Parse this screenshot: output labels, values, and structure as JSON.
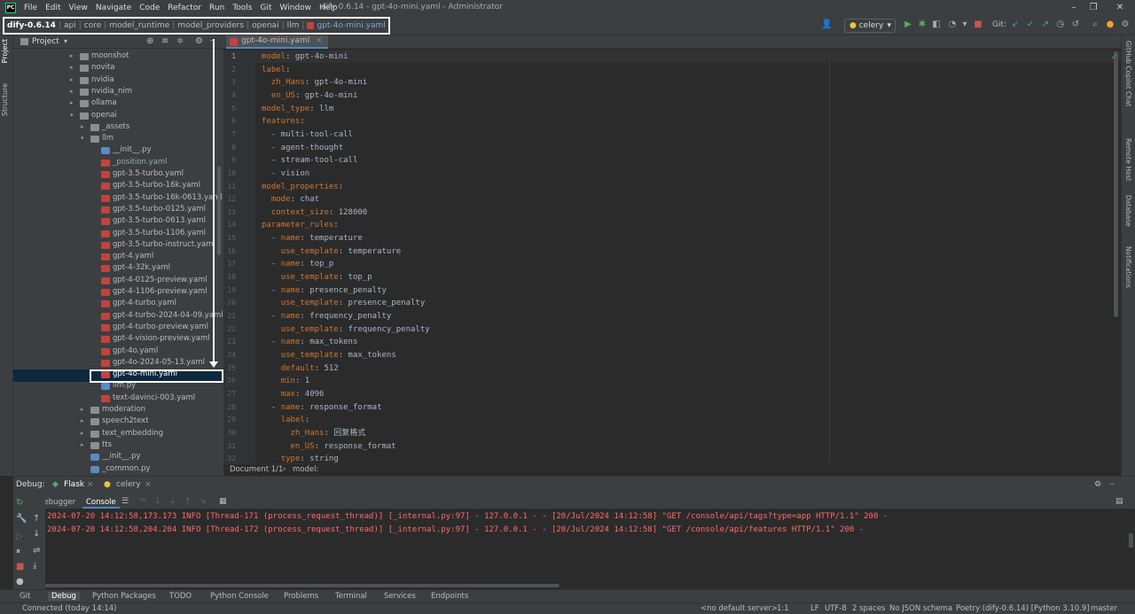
{
  "menu": {
    "items": [
      "File",
      "Edit",
      "View",
      "Navigate",
      "Code",
      "Refactor",
      "Run",
      "Tools",
      "Git",
      "Window",
      "Help"
    ],
    "window_title": "dify-0.6.14 - gpt-4o-mini.yaml - Administrator"
  },
  "navbar": {
    "crumbs": [
      "dify-0.6.14",
      "api",
      "core",
      "model_runtime",
      "model_providers",
      "openai",
      "llm",
      "gpt-4o-mini.yaml"
    ],
    "run_config": "celery",
    "git_label": "Git:"
  },
  "left_strip": {
    "project": "Project",
    "structure": "Structure"
  },
  "project": {
    "title": "Project",
    "tree": [
      {
        "label": "moonshot",
        "kind": "folder",
        "depth": 0,
        "expanded": false
      },
      {
        "label": "novita",
        "kind": "folder",
        "depth": 0,
        "expanded": false
      },
      {
        "label": "nvidia",
        "kind": "folder",
        "depth": 0,
        "expanded": false
      },
      {
        "label": "nvidia_nim",
        "kind": "folder",
        "depth": 0,
        "expanded": false
      },
      {
        "label": "ollama",
        "kind": "folder",
        "depth": 0,
        "expanded": false
      },
      {
        "label": "openai",
        "kind": "folder",
        "depth": 0,
        "expanded": true
      },
      {
        "label": "_assets",
        "kind": "folder",
        "depth": 1,
        "expanded": false
      },
      {
        "label": "llm",
        "kind": "folder",
        "depth": 1,
        "expanded": true
      },
      {
        "label": "__init__.py",
        "kind": "py",
        "depth": 2
      },
      {
        "label": "_position.yaml",
        "kind": "yaml",
        "depth": 2,
        "highlight": true
      },
      {
        "label": "gpt-3.5-turbo.yaml",
        "kind": "yaml",
        "depth": 2
      },
      {
        "label": "gpt-3.5-turbo-16k.yaml",
        "kind": "yaml",
        "depth": 2
      },
      {
        "label": "gpt-3.5-turbo-16k-0613.yaml",
        "kind": "yaml",
        "depth": 2
      },
      {
        "label": "gpt-3.5-turbo-0125.yaml",
        "kind": "yaml",
        "depth": 2
      },
      {
        "label": "gpt-3.5-turbo-0613.yaml",
        "kind": "yaml",
        "depth": 2
      },
      {
        "label": "gpt-3.5-turbo-1106.yaml",
        "kind": "yaml",
        "depth": 2
      },
      {
        "label": "gpt-3.5-turbo-instruct.yaml",
        "kind": "yaml",
        "depth": 2
      },
      {
        "label": "gpt-4.yaml",
        "kind": "yaml",
        "depth": 2
      },
      {
        "label": "gpt-4-32k.yaml",
        "kind": "yaml",
        "depth": 2
      },
      {
        "label": "gpt-4-0125-preview.yaml",
        "kind": "yaml",
        "depth": 2
      },
      {
        "label": "gpt-4-1106-preview.yaml",
        "kind": "yaml",
        "depth": 2
      },
      {
        "label": "gpt-4-turbo.yaml",
        "kind": "yaml",
        "depth": 2
      },
      {
        "label": "gpt-4-turbo-2024-04-09.yaml",
        "kind": "yaml",
        "depth": 2
      },
      {
        "label": "gpt-4-turbo-preview.yaml",
        "kind": "yaml",
        "depth": 2
      },
      {
        "label": "gpt-4-vision-preview.yaml",
        "kind": "yaml",
        "depth": 2
      },
      {
        "label": "gpt-4o.yaml",
        "kind": "yaml",
        "depth": 2
      },
      {
        "label": "gpt-4o-2024-05-13.yaml",
        "kind": "yaml",
        "depth": 2
      },
      {
        "label": "gpt-4o-mini.yaml",
        "kind": "yaml",
        "depth": 2,
        "selected": true
      },
      {
        "label": "llm.py",
        "kind": "py",
        "depth": 2
      },
      {
        "label": "text-davinci-003.yaml",
        "kind": "yaml",
        "depth": 2
      },
      {
        "label": "moderation",
        "kind": "folder",
        "depth": 1,
        "expanded": false
      },
      {
        "label": "speech2text",
        "kind": "folder",
        "depth": 1,
        "expanded": false
      },
      {
        "label": "text_embedding",
        "kind": "folder",
        "depth": 1,
        "expanded": false
      },
      {
        "label": "tts",
        "kind": "folder",
        "depth": 1,
        "expanded": false
      },
      {
        "label": "__init__.py",
        "kind": "py",
        "depth": 1
      },
      {
        "label": "_common.py",
        "kind": "py",
        "depth": 1
      }
    ]
  },
  "editor": {
    "tab": "gpt-4o-mini.yaml",
    "lines": [
      [
        [
          "k",
          "model"
        ],
        [
          "v",
          ": gpt-4o-mini"
        ]
      ],
      [
        [
          "k",
          "label"
        ],
        [
          "v",
          ":"
        ]
      ],
      [
        [
          "v",
          "  "
        ],
        [
          "k",
          "zh_Hans"
        ],
        [
          "v",
          ": gpt-4o-mini"
        ]
      ],
      [
        [
          "v",
          "  "
        ],
        [
          "k",
          "en_US"
        ],
        [
          "v",
          ": gpt-4o-mini"
        ]
      ],
      [
        [
          "k",
          "model_type"
        ],
        [
          "v",
          ": llm"
        ]
      ],
      [
        [
          "k",
          "features"
        ],
        [
          "v",
          ":"
        ]
      ],
      [
        [
          "v",
          "  - multi-tool-call"
        ]
      ],
      [
        [
          "v",
          "  - agent-thought"
        ]
      ],
      [
        [
          "v",
          "  - stream-tool-call"
        ]
      ],
      [
        [
          "v",
          "  - vision"
        ]
      ],
      [
        [
          "k",
          "model_properties"
        ],
        [
          "v",
          ":"
        ]
      ],
      [
        [
          "v",
          "  "
        ],
        [
          "k",
          "mode"
        ],
        [
          "v",
          ": chat"
        ]
      ],
      [
        [
          "v",
          "  "
        ],
        [
          "k",
          "context_size"
        ],
        [
          "v",
          ": 128000"
        ]
      ],
      [
        [
          "k",
          "parameter_rules"
        ],
        [
          "v",
          ":"
        ]
      ],
      [
        [
          "v",
          "  - "
        ],
        [
          "k",
          "name"
        ],
        [
          "v",
          ": temperature"
        ]
      ],
      [
        [
          "v",
          "    "
        ],
        [
          "k",
          "use_template"
        ],
        [
          "v",
          ": temperature"
        ]
      ],
      [
        [
          "v",
          "  - "
        ],
        [
          "k",
          "name"
        ],
        [
          "v",
          ": top_p"
        ]
      ],
      [
        [
          "v",
          "    "
        ],
        [
          "k",
          "use_template"
        ],
        [
          "v",
          ": top_p"
        ]
      ],
      [
        [
          "v",
          "  - "
        ],
        [
          "k",
          "name"
        ],
        [
          "v",
          ": presence_penalty"
        ]
      ],
      [
        [
          "v",
          "    "
        ],
        [
          "k",
          "use_template"
        ],
        [
          "v",
          ": presence_penalty"
        ]
      ],
      [
        [
          "v",
          "  - "
        ],
        [
          "k",
          "name"
        ],
        [
          "v",
          ": frequency_penalty"
        ]
      ],
      [
        [
          "v",
          "    "
        ],
        [
          "k",
          "use_template"
        ],
        [
          "v",
          ": frequency_penalty"
        ]
      ],
      [
        [
          "v",
          "  - "
        ],
        [
          "k",
          "name"
        ],
        [
          "v",
          ": max_tokens"
        ]
      ],
      [
        [
          "v",
          "    "
        ],
        [
          "k",
          "use_template"
        ],
        [
          "v",
          ": max_tokens"
        ]
      ],
      [
        [
          "v",
          "    "
        ],
        [
          "k",
          "default"
        ],
        [
          "v",
          ": 512"
        ]
      ],
      [
        [
          "v",
          "    "
        ],
        [
          "k",
          "min"
        ],
        [
          "v",
          ": 1"
        ]
      ],
      [
        [
          "v",
          "    "
        ],
        [
          "k",
          "max"
        ],
        [
          "v",
          ": 4096"
        ]
      ],
      [
        [
          "v",
          "  - "
        ],
        [
          "k",
          "name"
        ],
        [
          "v",
          ": response_format"
        ]
      ],
      [
        [
          "v",
          "    "
        ],
        [
          "k",
          "label"
        ],
        [
          "v",
          ":"
        ]
      ],
      [
        [
          "v",
          "      "
        ],
        [
          "k",
          "zh_Hans"
        ],
        [
          "v",
          ": 回复格式"
        ]
      ],
      [
        [
          "v",
          "      "
        ],
        [
          "k",
          "en_US"
        ],
        [
          "v",
          ": response_format"
        ]
      ],
      [
        [
          "v",
          "    "
        ],
        [
          "k",
          "type"
        ],
        [
          "v",
          ": string"
        ]
      ]
    ],
    "breadcrumb": {
      "doc": "Document 1/1",
      "sep": "›",
      "path": "model:"
    }
  },
  "right_strip": {
    "copilot": "GitHub Copilot Chat",
    "remote": "Remote Host",
    "database": "Database",
    "notifications": "Notifications"
  },
  "debug": {
    "label": "Debug:",
    "tabs": [
      "Flask",
      "celery"
    ],
    "subtabs": [
      "Debugger",
      "Console"
    ],
    "log": [
      "2024-07-20 14:12:58,173.173 INFO [Thread-171 (process_request_thread)] [_internal.py:97] - 127.0.0.1 - - [20/Jul/2024 14:12:58] \"GET /console/api/tags?type=app HTTP/1.1\" 200 -",
      "2024-07-20 14:12:58,204.204 INFO [Thread-172 (process_request_thread)] [_internal.py:97] - 127.0.0.1 - - [20/Jul/2024 14:12:58] \"GET /console/api/features HTTP/1.1\" 200 -"
    ]
  },
  "bottom_tabs": [
    "Git",
    "Debug",
    "Python Packages",
    "TODO",
    "Python Console",
    "Problems",
    "Terminal",
    "Services",
    "Endpoints"
  ],
  "status": {
    "left": "Connected (today 14:14)",
    "server": "<no default server>",
    "pos": "1:1",
    "eol": "LF",
    "enc": "UTF-8",
    "indent": "2 spaces",
    "schema": "No JSON schema",
    "interp": "Poetry (dify-0.6.14) [Python 3.10.9]",
    "branch": "master"
  },
  "colors": {
    "accent": "#4a88c7",
    "key": "#cc7832",
    "log": "#ff6b68",
    "selection": "#0d293e"
  }
}
